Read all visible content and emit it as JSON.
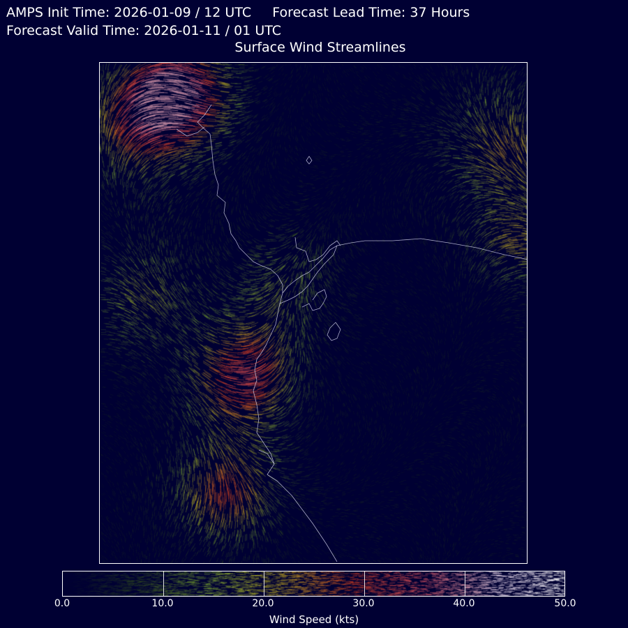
{
  "header": {
    "init_label": "AMPS Init Time: 2026-01-09 / 12 UTC",
    "lead_label": "Forecast Lead Time: 37 Hours",
    "valid_label": "Forecast Valid Time: 2026-01-11 / 01 UTC"
  },
  "map": {
    "title": "Surface Wind Streamlines",
    "background_color": "#000033",
    "coastline_color": "#c8c8e0"
  },
  "colorbar": {
    "label": "Wind Speed (kts)",
    "ticks": [
      "0.0",
      "10.0",
      "20.0",
      "30.0",
      "40.0",
      "50.0"
    ],
    "min": 0,
    "max": 50,
    "colors": [
      "#000033",
      "#3a5a1a",
      "#8fbf30",
      "#c8b020",
      "#c83a20",
      "#d05060",
      "#d0c0d8",
      "#ffffff"
    ]
  }
}
